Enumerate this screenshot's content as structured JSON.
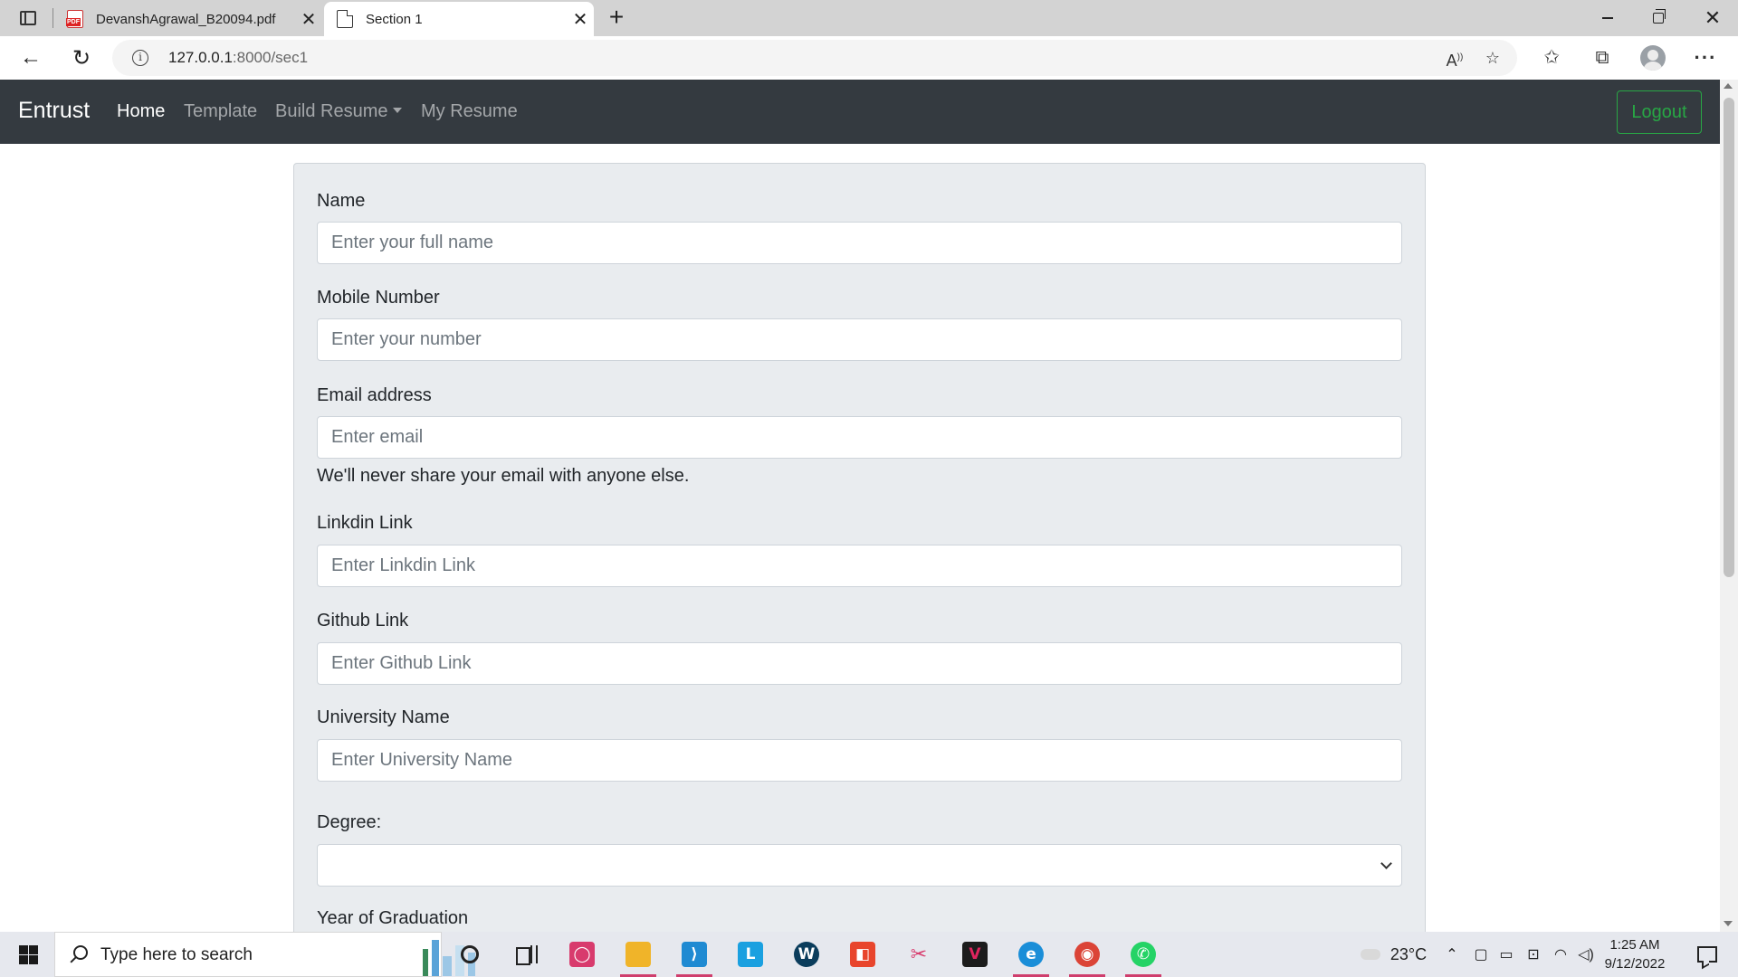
{
  "browser": {
    "tabs": [
      {
        "title": "DevanshAgrawal_B20094.pdf",
        "icon": "pdf-icon",
        "active": false
      },
      {
        "title": "Section 1",
        "icon": "page-icon",
        "active": true
      }
    ],
    "new_tab_label": "+",
    "close_label": "✕",
    "url_host": "127.0.0.1",
    "url_path": ":8000/sec1"
  },
  "app": {
    "brand": "Entrust",
    "nav": {
      "home": "Home",
      "template": "Template",
      "build_resume": "Build Resume",
      "my_resume": "My Resume"
    },
    "logout_label": "Logout",
    "accent_color": "#28a745",
    "navbar_color": "#343a40"
  },
  "form": {
    "name": {
      "label": "Name",
      "placeholder": "Enter your full name",
      "value": ""
    },
    "mobile": {
      "label": "Mobile Number",
      "placeholder": "Enter your number",
      "value": ""
    },
    "email": {
      "label": "Email address",
      "placeholder": "Enter email",
      "value": "",
      "help": "We'll never share your email with anyone else."
    },
    "linkedin": {
      "label": "Linkdin Link",
      "placeholder": "Enter Linkdin Link",
      "value": ""
    },
    "github": {
      "label": "Github Link",
      "placeholder": "Enter Github Link",
      "value": ""
    },
    "university": {
      "label": "University Name",
      "placeholder": "Enter University Name",
      "value": ""
    },
    "degree": {
      "label": "Degree:",
      "selected": ""
    },
    "year": {
      "label": "Year of Graduation"
    }
  },
  "taskbar": {
    "search_placeholder": "Type here to search",
    "temperature": "23°C",
    "time": "1:25 AM",
    "date": "9/12/2022"
  }
}
